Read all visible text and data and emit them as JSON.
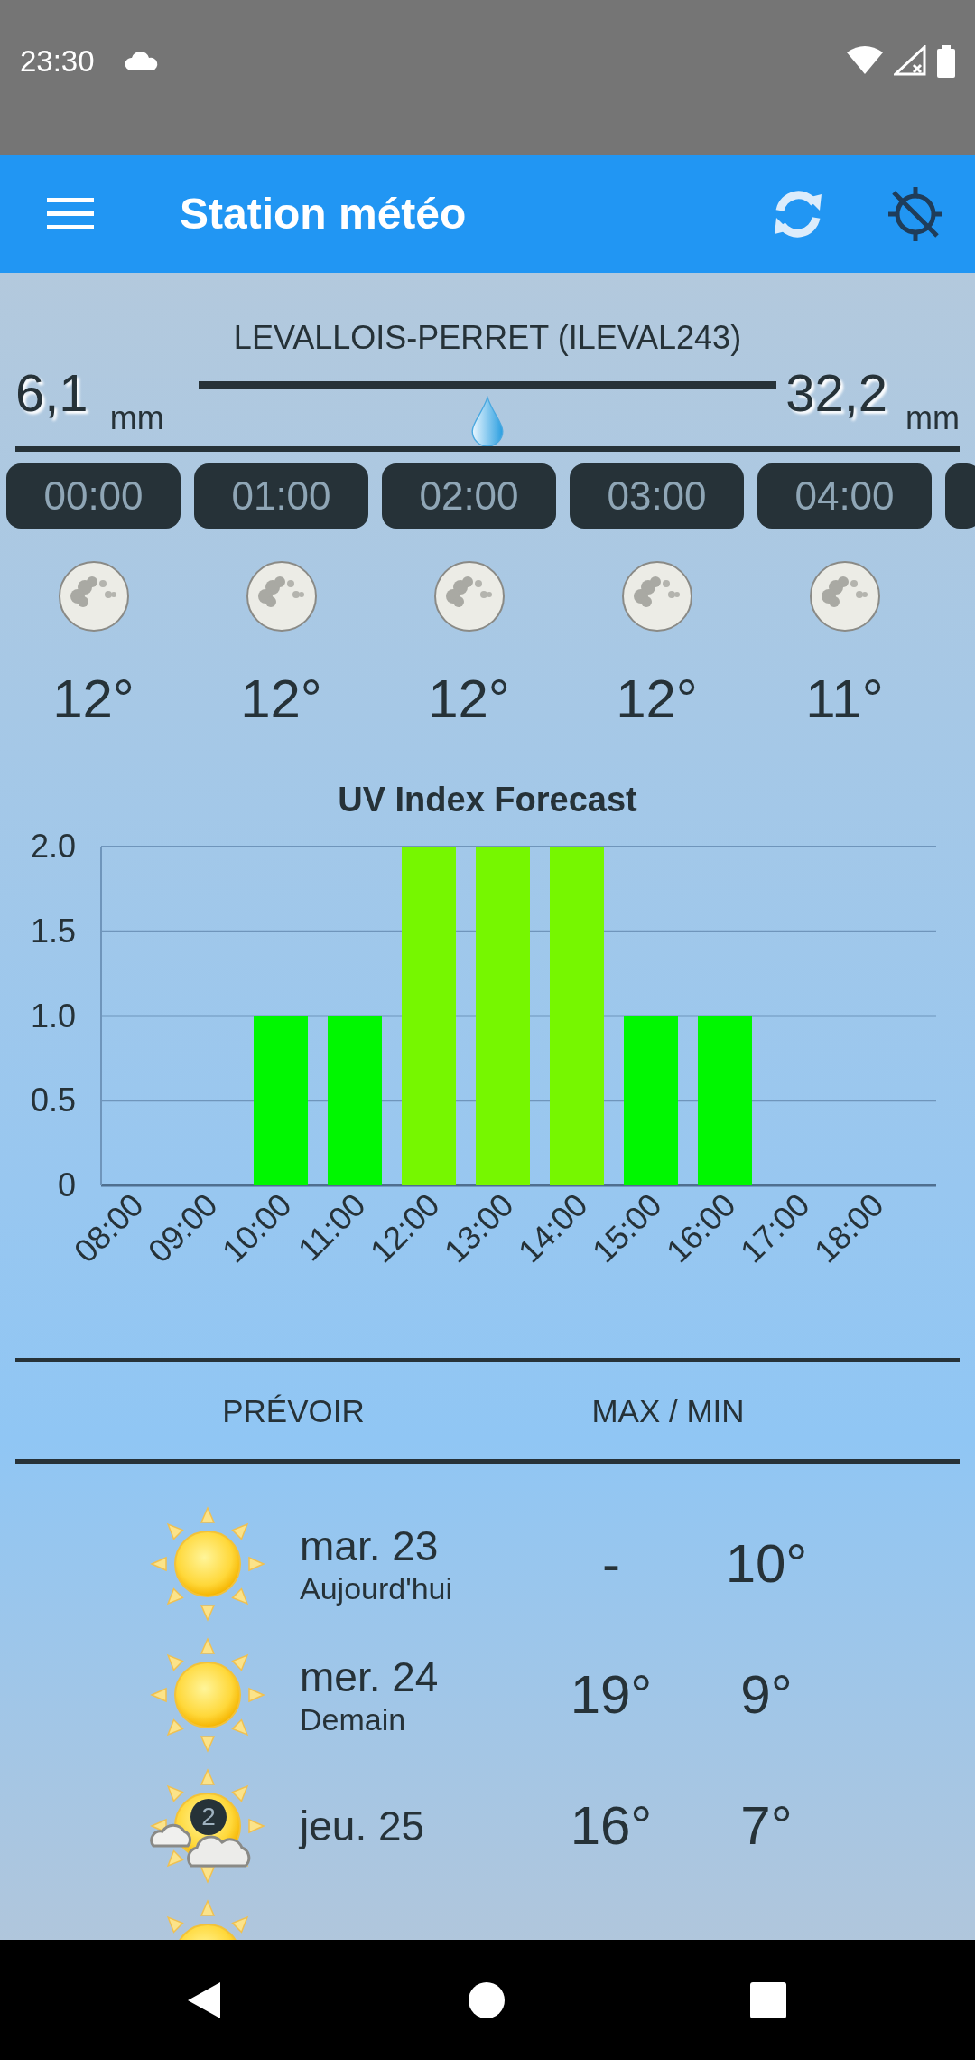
{
  "status_bar": {
    "time": "23:30"
  },
  "app_bar": {
    "title": "Station météo"
  },
  "station": {
    "name": "LEVALLOIS-PERRET (ILEVAL243)"
  },
  "rain": {
    "left_value": "6,1",
    "left_unit": "mm",
    "right_value": "32,2",
    "right_unit": "mm"
  },
  "hourly": [
    {
      "time": "00:00",
      "kind": "moon",
      "temp": "12°"
    },
    {
      "time": "01:00",
      "kind": "moon",
      "temp": "12°"
    },
    {
      "time": "02:00",
      "kind": "moon",
      "temp": "12°"
    },
    {
      "time": "03:00",
      "kind": "moon",
      "temp": "12°"
    },
    {
      "time": "04:00",
      "kind": "moon",
      "temp": "11°"
    }
  ],
  "uv_chart": {
    "chart_data": {
      "type": "bar",
      "title": "UV Index Forecast",
      "categories": [
        "08:00",
        "09:00",
        "10:00",
        "11:00",
        "12:00",
        "13:00",
        "14:00",
        "15:00",
        "16:00",
        "17:00",
        "18:00"
      ],
      "series": [
        {
          "colors": [
            "#00f700",
            "#00f700",
            "#00f700",
            "#00f700",
            "#76f700",
            "#76f700",
            "#76f700",
            "#00f700",
            "#00f700",
            "#00f700",
            "#00f700"
          ],
          "values": [
            0,
            0,
            1,
            1,
            2,
            2,
            2,
            1,
            1,
            0,
            0
          ]
        }
      ],
      "grid": true,
      "ylim": [
        0,
        2
      ],
      "yticks": [
        {
          "value": 0,
          "label": "0"
        },
        {
          "value": 0.5,
          "label": "0.5"
        },
        {
          "value": 1,
          "label": "1.0"
        },
        {
          "value": 1.5,
          "label": "1.5"
        },
        {
          "value": 2,
          "label": "2.0"
        }
      ]
    }
  },
  "forecast": {
    "columns": [
      "PRÉVOIR",
      "MAX / MIN"
    ],
    "days": [
      {
        "kind": "sun",
        "day": "mar. 23",
        "label": "Aujourd'hui",
        "max": "-",
        "min": "10°"
      },
      {
        "kind": "sun",
        "day": "mer. 24",
        "label": "Demain",
        "max": "19°",
        "min": "9°"
      },
      {
        "kind": "sun_cloud",
        "badge": "2",
        "day": "jeu. 25",
        "max": "16°",
        "min": "7°"
      },
      {
        "kind": "sun"
      }
    ]
  }
}
